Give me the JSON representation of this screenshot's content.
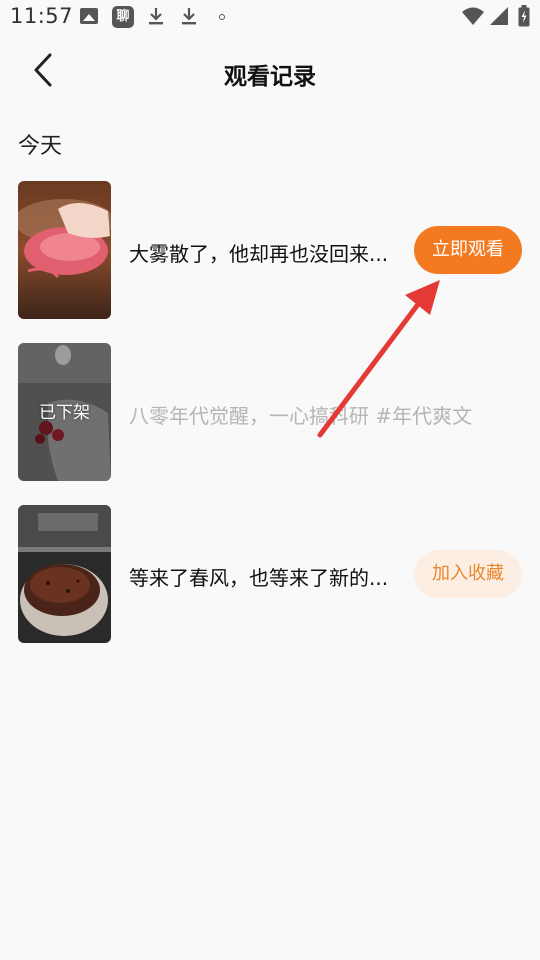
{
  "status_bar": {
    "time": "11:57",
    "app_badge": "聊"
  },
  "header": {
    "title": "观看记录"
  },
  "section": {
    "title": "今天"
  },
  "items": [
    {
      "title": "大雾散了，他却再也没回来...",
      "action": "立即观看",
      "badge": ""
    },
    {
      "title": "八零年代觉醒，一心搞科研 #年代爽文",
      "action": "",
      "badge": "已下架"
    },
    {
      "title": "等来了春风，也等来了新的...",
      "action": "加入收藏",
      "badge": ""
    }
  ],
  "colors": {
    "accent": "#f47a22",
    "accent_soft": "#fdeee3",
    "annotation_arrow": "#e53935"
  }
}
